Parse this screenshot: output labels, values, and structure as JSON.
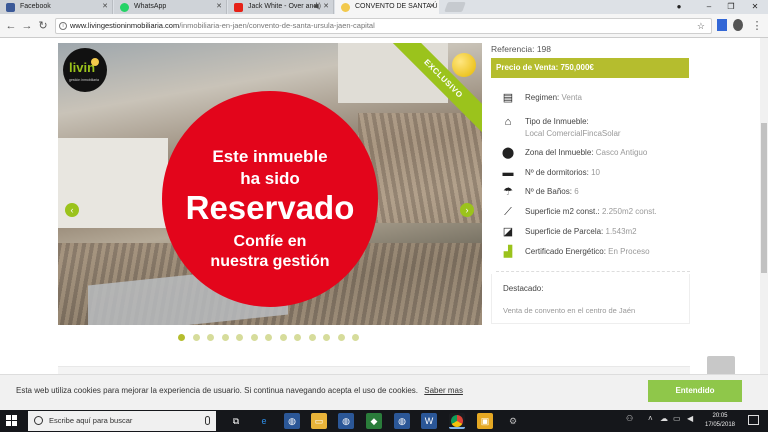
{
  "browser": {
    "tabs": [
      {
        "label": "Facebook",
        "active": false
      },
      {
        "label": "WhatsApp",
        "active": false
      },
      {
        "label": "Jack White - Over and",
        "active": false
      },
      {
        "label": "CONVENTO DE SANTA Ú",
        "active": true
      }
    ],
    "url_host": "www.livingestioninmobiliaria.com",
    "url_path": "/inmobiliaria-en-jaen/convento-de-santa-ursula-jaen-capital",
    "window_controls": [
      "–",
      "❐",
      "✕"
    ]
  },
  "listing": {
    "logo_text": "livin",
    "logo_subtitle": "gestión inmobiliaria",
    "ribbon": "EXCLUSIVO",
    "stamp": {
      "line1": "Este inmueble",
      "line2": "ha sido",
      "line3": "Reservado",
      "line4": "Confíe en",
      "line5": "nuestra gestión"
    },
    "slide_count": 13,
    "active_slide": 1,
    "reference": "Referencia: 198",
    "price": "Precio de Venta: 750,000€",
    "properties": [
      {
        "icon": "regimen-icon",
        "label": "Regimen:",
        "value": "Venta"
      },
      {
        "icon": "home-icon",
        "label": "Tipo de Inmueble:",
        "value": "Local ComercialFincaSolar"
      },
      {
        "icon": "location-pin-icon",
        "label": "Zona del Inmueble:",
        "value": "Casco Antiguo"
      },
      {
        "icon": "bed-icon",
        "label": "Nº de dormitorios:",
        "value": "10"
      },
      {
        "icon": "shower-icon",
        "label": "Nº de Baños:",
        "value": "6"
      },
      {
        "icon": "ruler-icon",
        "label": "Superficie m2 const.:",
        "value": "2.250m2 const."
      },
      {
        "icon": "area-icon",
        "label": "Superficie de Parcela:",
        "value": "1.543m2"
      },
      {
        "icon": "energy-icon",
        "label": "Certificado Energético:",
        "value": "En Proceso"
      }
    ],
    "highlight_title": "Destacado:",
    "highlight_text": "Venta de convento en el centro de Jaén"
  },
  "cookie": {
    "text": "Esta web utiliza cookies para mejorar la experiencia de usuario. Si continua navegando acepta el uso de cookies.",
    "link": "Saber mas",
    "button": "Entendido"
  },
  "taskbar": {
    "search_placeholder": "Escribe aquí para buscar",
    "time": "20:05",
    "date": "17/05/2018"
  },
  "colors": {
    "brand_green": "#9bc31c",
    "price_bar": "#b5bd2e",
    "stamp_red": "#e3051b",
    "cookie_button": "#8fc74a"
  }
}
